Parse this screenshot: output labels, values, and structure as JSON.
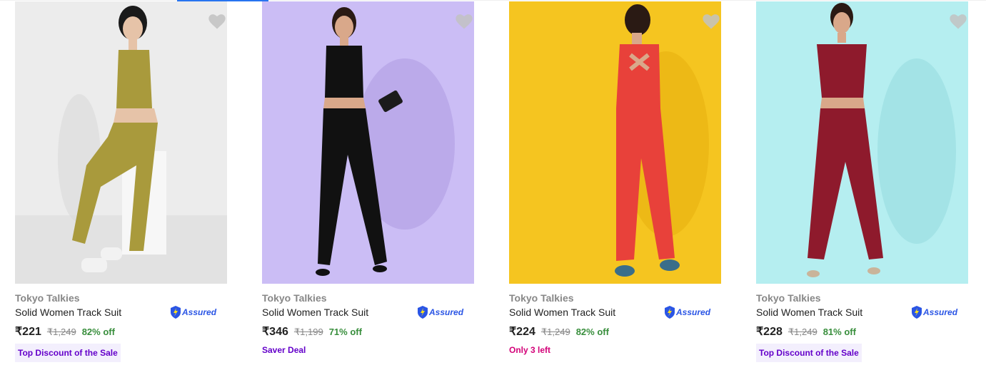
{
  "products": [
    {
      "brand": "Tokyo Talkies",
      "title": "Solid Women Track Suit",
      "assured": "Assured",
      "price": "₹221",
      "mrp": "₹1,249",
      "discount": "82% off",
      "tag": "Top Discount of the Sale",
      "colors": {
        "bg": "#ececec",
        "outfit": "#a99a3c"
      }
    },
    {
      "brand": "Tokyo Talkies",
      "title": "Solid Women Track Suit",
      "assured": "Assured",
      "price": "₹346",
      "mrp": "₹1,199",
      "discount": "71% off",
      "tag": "Saver Deal",
      "colors": {
        "bg": "#cbbdf5",
        "outfit": "#111111"
      }
    },
    {
      "brand": "Tokyo Talkies",
      "title": "Solid Women Track Suit",
      "assured": "Assured",
      "price": "₹224",
      "mrp": "₹1,249",
      "discount": "82% off",
      "tag": "Only 3 left",
      "colors": {
        "bg": "#f5c520",
        "outfit": "#e8413a"
      }
    },
    {
      "brand": "Tokyo Talkies",
      "title": "Solid Women Track Suit",
      "assured": "Assured",
      "price": "₹228",
      "mrp": "₹1,249",
      "discount": "81% off",
      "tag": "Top Discount of the Sale",
      "colors": {
        "bg": "#b5eef0",
        "outfit": "#8e1a2c"
      }
    }
  ],
  "icons": {
    "wishlist": "heart-icon",
    "assured": "assured-shield-icon"
  },
  "theme": {
    "price_green": "#388e3c",
    "tag_purple": "#6400ca",
    "stock_pink": "#d30078",
    "assured_blue": "#2a55e5"
  }
}
